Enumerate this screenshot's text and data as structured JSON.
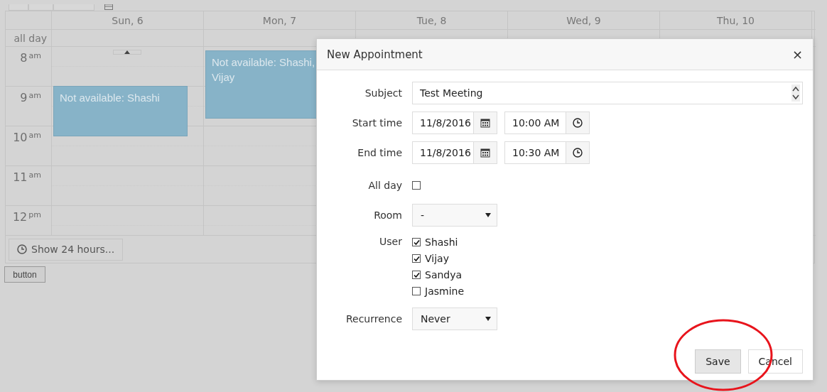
{
  "calendar": {
    "all_day_label": "all day",
    "days": [
      {
        "label": "Sun, 6",
        "events": [
          {
            "title": "Not available: Shashi"
          }
        ]
      },
      {
        "label": "Mon, 7",
        "events": [
          {
            "title": "Not available: Shashi, Vijay"
          }
        ]
      },
      {
        "label": "Tue, 8"
      },
      {
        "label": "Wed, 9"
      },
      {
        "label": "Thu, 10"
      }
    ],
    "hours": [
      {
        "hour": "8",
        "period": "am"
      },
      {
        "hour": "9",
        "period": "am"
      },
      {
        "hour": "10",
        "period": "am"
      },
      {
        "hour": "11",
        "period": "am"
      },
      {
        "hour": "12",
        "period": "pm"
      }
    ],
    "show_hours_button": "Show 24 hours..."
  },
  "page_button": "button",
  "dialog": {
    "title": "New Appointment",
    "close": "×",
    "fields": [
      {
        "kind": "text",
        "label": "Subject",
        "value": "Test Meeting"
      },
      {
        "kind": "datetime",
        "label": "Start time",
        "date": "11/8/2016",
        "time": "10:00 AM"
      },
      {
        "kind": "datetime",
        "label": "End time",
        "date": "11/8/2016",
        "time": "10:30 AM"
      },
      {
        "kind": "checkbox",
        "label": "All day",
        "checked": false
      },
      {
        "kind": "dropdown",
        "label": "Room",
        "value": "-"
      },
      {
        "kind": "checklist",
        "label": "User",
        "options": [
          {
            "label": "Shashi",
            "checked": true
          },
          {
            "label": "Vijay",
            "checked": true
          },
          {
            "label": "Sandya",
            "checked": true
          },
          {
            "label": "Jasmine",
            "checked": false
          }
        ]
      },
      {
        "kind": "dropdown",
        "label": "Recurrence",
        "value": "Never"
      }
    ],
    "buttons": [
      {
        "label": "Save",
        "primary": true
      },
      {
        "label": "Cancel",
        "primary": false
      }
    ]
  }
}
